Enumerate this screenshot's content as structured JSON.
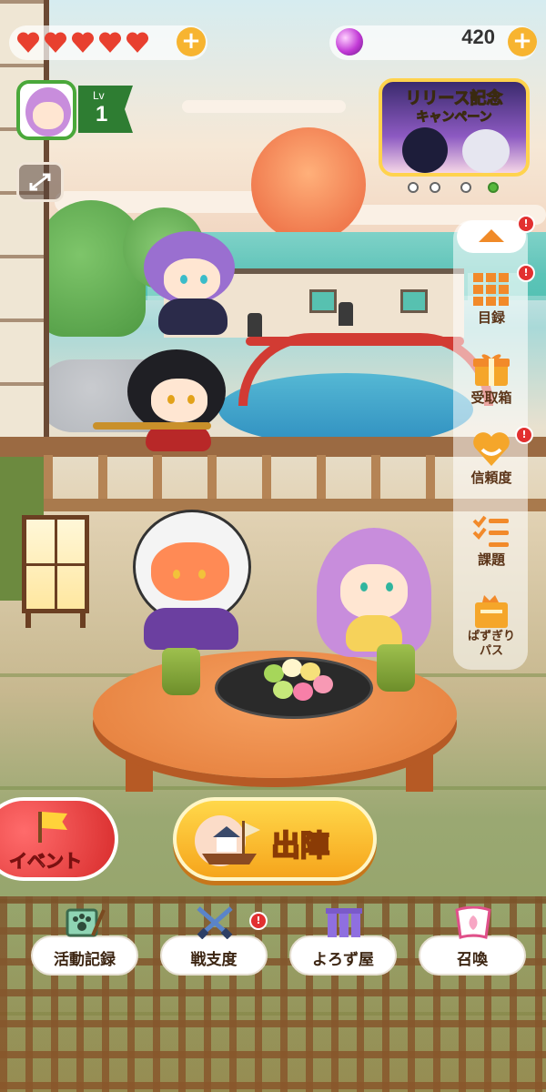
{
  "status_bar": {
    "hearts": 5,
    "currency_count": "420",
    "plus_label": "+"
  },
  "player": {
    "level_label": "Lv",
    "level": "1"
  },
  "campaign_banner": {
    "line1": "リリース記念",
    "line2": "キャンペーン",
    "carousel_pages": 4,
    "active_page": 4
  },
  "side_menu": {
    "items": [
      {
        "label": "目録",
        "icon": "grid-icon",
        "badge": "!"
      },
      {
        "label": "受取箱",
        "icon": "gift-box-icon",
        "badge": ""
      },
      {
        "label": "信頼度",
        "icon": "heart-icon",
        "badge": "!"
      },
      {
        "label": "課題",
        "icon": "checklist-icon",
        "badge": ""
      },
      {
        "label": "ぱずぎり\nパス",
        "icon": "pass-ticket-icon",
        "badge": ""
      }
    ],
    "collapse_badge": "!"
  },
  "actions": {
    "event_label": "イベント",
    "sortie_label": "出陣"
  },
  "bottom_nav": [
    {
      "label": "活動記録",
      "icon": "paw-painting-icon",
      "badge": ""
    },
    {
      "label": "戦支度",
      "icon": "crossed-swords-icon",
      "badge": "!"
    },
    {
      "label": "よろず屋",
      "icon": "shop-curtain-icon",
      "badge": ""
    },
    {
      "label": "召喚",
      "icon": "summon-scroll-icon",
      "badge": ""
    }
  ],
  "colors": {
    "accent_orange": "#f7b430",
    "heart_red": "#e8402f",
    "level_green": "#2e7d32",
    "badge_red": "#e23030",
    "event_red": "#d82c2c",
    "sortie_gold": "#f6a51c"
  }
}
